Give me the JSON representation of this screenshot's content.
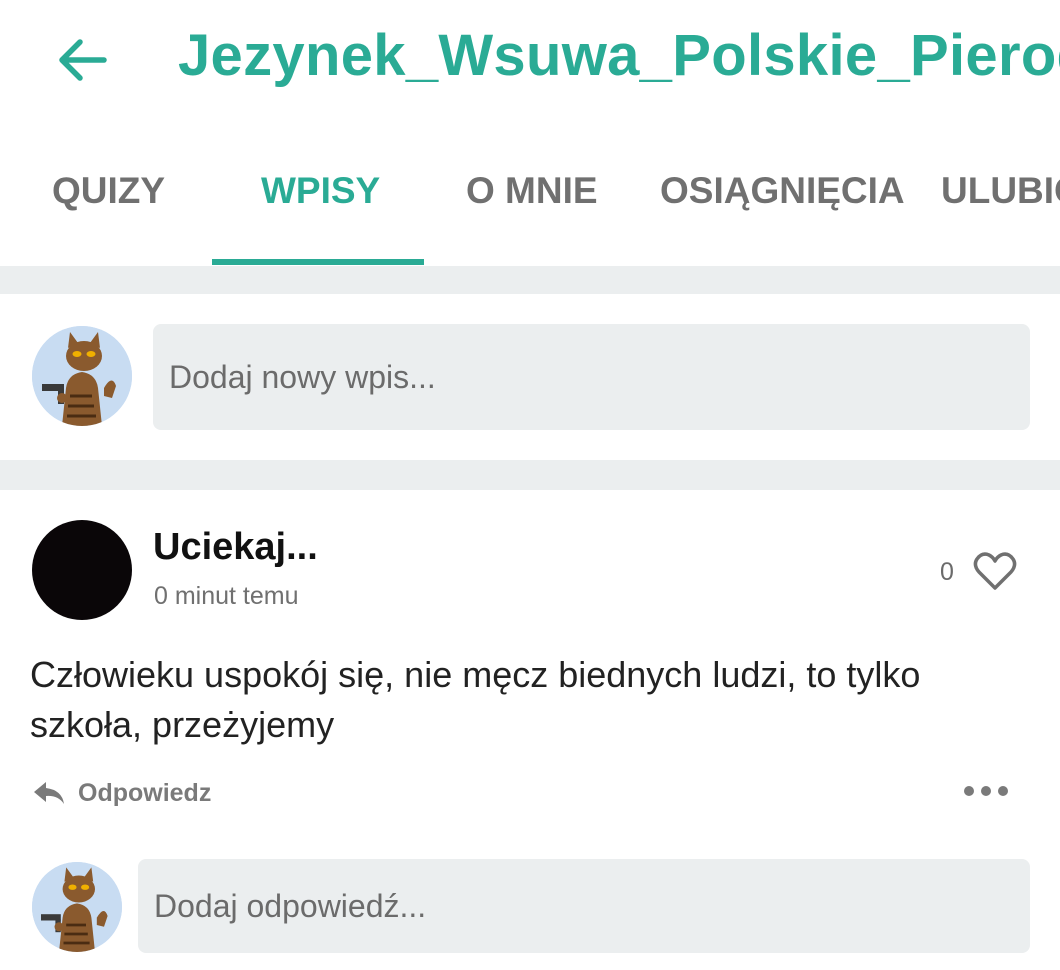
{
  "header": {
    "back_icon": "arrow-left-icon",
    "title": "Jezynek_Wsuwa_Polskie_Pierogi",
    "accent_color": "#2aab95"
  },
  "tabs": [
    {
      "label": "QUIZY",
      "active": false
    },
    {
      "label": "WPISY",
      "active": true
    },
    {
      "label": "O MNIE",
      "active": false
    },
    {
      "label": "OSIĄGNIĘCIA",
      "active": false
    },
    {
      "label": "ULUBIO",
      "active": false
    }
  ],
  "composer": {
    "placeholder": "Dodaj nowy wpis..."
  },
  "post": {
    "author": "Uciekaj...",
    "time": "0 minut temu",
    "likes": "0",
    "like_icon": "heart-icon",
    "text": "Człowieku uspokój się, nie męcz biednych ludzi, to tylko szkoła, przeżyjemy",
    "reply_label": "Odpowiedz",
    "reply_icon": "reply-arrow-icon",
    "more_icon": "more-dots-icon"
  },
  "reply_composer": {
    "placeholder": "Dodaj odpowiedź..."
  }
}
